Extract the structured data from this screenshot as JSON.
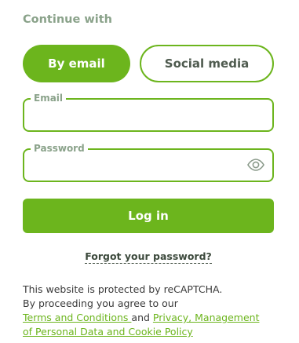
{
  "heading": "Continue with",
  "tabs": {
    "email": "By email",
    "social": "Social media"
  },
  "form": {
    "email_label": "Email",
    "email_value": "",
    "password_label": "Password",
    "password_value": "",
    "password_toggle_icon": "eye-icon",
    "login_label": "Log in",
    "forgot_label": "Forgot your password?"
  },
  "legal": {
    "recaptcha_text": "This website is protected by reCAPTCHA.",
    "agree_text": "By proceeding you agree to our",
    "terms_link": "Terms and Conditions ",
    "and_text": " and ",
    "privacy_link_part1": "Privacy, Management",
    "privacy_link_part2": "of Personal Data and Cookie Policy"
  },
  "colors": {
    "accent": "#6cb51d",
    "muted_label": "#8aa28a",
    "text": "#3a3a3a"
  }
}
